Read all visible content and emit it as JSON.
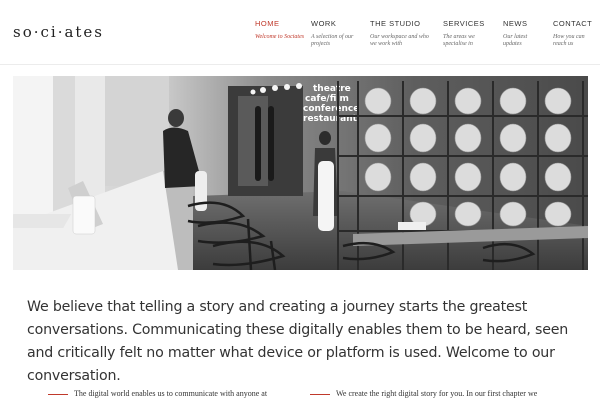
{
  "brand": {
    "logo_text": "so·ci·ates"
  },
  "nav": {
    "items": [
      {
        "label": "HOME",
        "sub": "Welcome to Sociates",
        "active": true
      },
      {
        "label": "WORK",
        "sub": "A selection of our projects",
        "active": false
      },
      {
        "label": "THE STUDIO",
        "sub": "Our workspace and who we work with",
        "active": false
      },
      {
        "label": "SERVICES",
        "sub": "The areas we specialise in",
        "active": false
      },
      {
        "label": "NEWS",
        "sub": "Our latest updates",
        "active": false
      },
      {
        "label": "CONTACT",
        "sub": "How you can reach us",
        "active": false
      }
    ]
  },
  "hero": {
    "sign_lines": [
      "theatre",
      "cafe/film",
      "conference",
      "restaurant"
    ]
  },
  "intro": {
    "text": "We believe that telling a story and creating a journey starts the greatest conversations. Communicating these digitally enables them to be heard, seen and critically felt no matter what device or platform is used. Welcome to our conversation."
  },
  "columns": [
    {
      "text": "The digital world enables us to communicate with anyone at"
    },
    {
      "text": "We create the right digital story for you. In our first chapter we"
    }
  ],
  "colors": {
    "accent": "#c0392b",
    "text": "#333333"
  }
}
